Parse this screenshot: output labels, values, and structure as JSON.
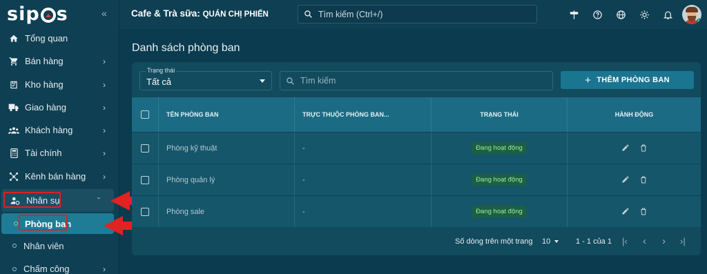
{
  "app": {
    "logo": "sipos",
    "store_name": "Cafe & Trà sữa:",
    "store_sub": "QUÁN CHỊ PHIẾN"
  },
  "header": {
    "search_placeholder": "Tìm kiếm (Ctrl+/)"
  },
  "sidebar": {
    "items": [
      {
        "label": "Tổng quan",
        "icon": "home-icon"
      },
      {
        "label": "Bán hàng",
        "icon": "cart-icon"
      },
      {
        "label": "Kho hàng",
        "icon": "inventory-icon"
      },
      {
        "label": "Giao hàng",
        "icon": "truck-icon"
      },
      {
        "label": "Khách hàng",
        "icon": "customers-icon"
      },
      {
        "label": "Tài chính",
        "icon": "calculator-icon"
      },
      {
        "label": "Kênh bán hàng",
        "icon": "channels-icon"
      },
      {
        "label": "Nhân sự",
        "icon": "staff-icon"
      }
    ],
    "sub_items": [
      {
        "label": "Phòng ban"
      },
      {
        "label": "Nhân viên"
      },
      {
        "label": "Chấm công"
      }
    ]
  },
  "page": {
    "title": "Danh sách phòng ban"
  },
  "toolbar": {
    "filter_label": "Trạng thái",
    "filter_value": "Tất cả",
    "search_placeholder": "Tìm kiếm",
    "add_label": "THÊM PHÒNG BAN"
  },
  "table": {
    "columns": [
      "TÊN PHÒNG BAN",
      "TRỰC THUỘC PHÒNG BAN...",
      "TRẠNG THÁI",
      "HÀNH ĐỘNG"
    ],
    "rows": [
      {
        "name": "Phòng kỹ thuật",
        "parent": "-",
        "status": "Đang hoạt động"
      },
      {
        "name": "Phòng quản lý",
        "parent": "-",
        "status": "Đang hoạt động"
      },
      {
        "name": "Phòng sale",
        "parent": "-",
        "status": "Đang hoạt động"
      }
    ]
  },
  "pagination": {
    "rows_per_page_label": "Số dòng trên một trang",
    "rows_per_page": "10",
    "range": "1 - 1 của 1"
  },
  "colors": {
    "accent": "#1a7591",
    "highlight": "#e02020",
    "status_bg": "#1f5e43",
    "status_text": "#8ff0a4"
  }
}
